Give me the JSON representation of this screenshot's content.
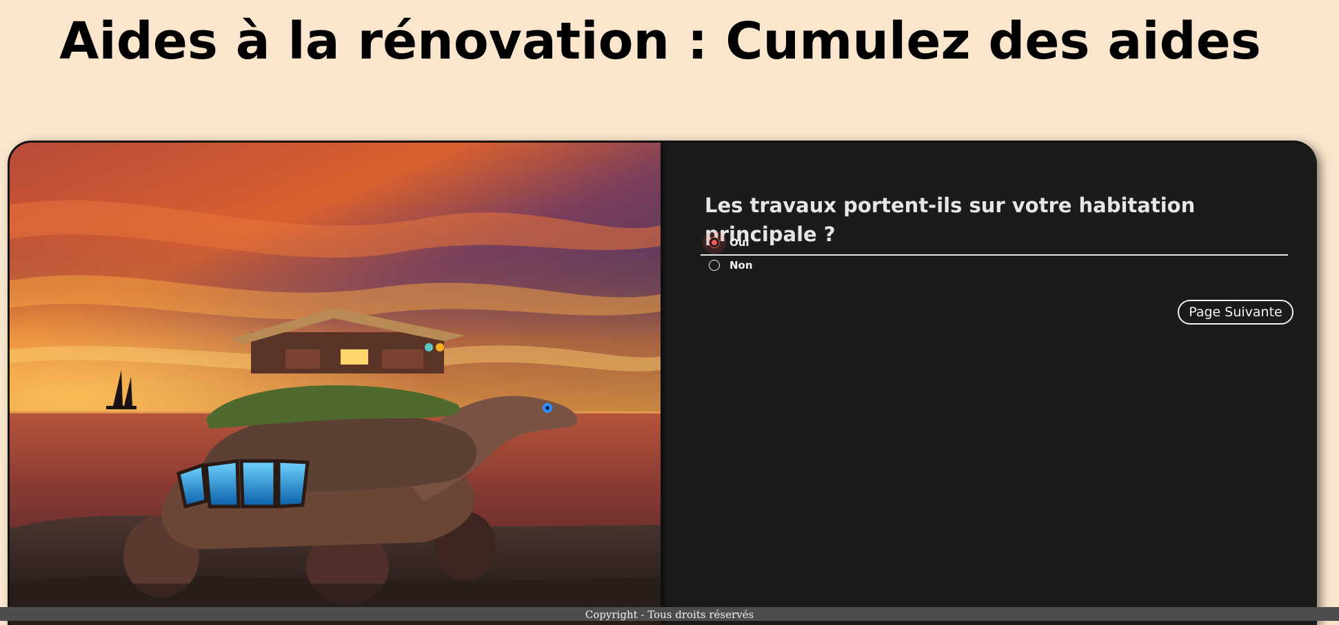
{
  "header": {
    "title": "Aides à la rénovation : Cumulez des aides"
  },
  "form": {
    "question": "Les travaux portent-ils sur votre habitation principale ?",
    "options": [
      {
        "label": "Oui",
        "checked": true
      },
      {
        "label": "Non",
        "checked": false
      }
    ],
    "next_label": "Page Suivante"
  },
  "footer": {
    "copyright": "Copyright - Tous droits réservés"
  },
  "colors": {
    "page_background": "#fae6cc",
    "card_background": "#1b1b1b",
    "radio_accent": "#f15a5a",
    "footer_background": "#4d4d4d"
  },
  "image": {
    "subject": "giant-tortoise-with-house-on-shell-at-sunset"
  }
}
